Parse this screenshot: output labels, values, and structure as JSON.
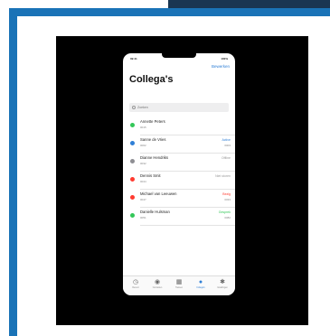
{
  "phone": {
    "status_time": "09:41",
    "status_right": "100%",
    "edit_label": "Bewerken",
    "title": "Collega's",
    "search_placeholder": "Zoeken"
  },
  "contacts": [
    {
      "name": "Annette Peters",
      "ext": "0015",
      "status": "",
      "ext2": "",
      "dot_color": "#34c759",
      "status_color": "#888888"
    },
    {
      "name": "Sanne de Vries",
      "ext": "0002",
      "status": "Active",
      "ext2": "0003",
      "dot_color": "#2f7fd6",
      "status_color": "#2f7fd6"
    },
    {
      "name": "Dianne Hendriks",
      "ext": "0032",
      "status": "Offline",
      "ext2": "",
      "dot_color": "#8e8e93",
      "status_color": "#999999"
    },
    {
      "name": "Dennis Smit",
      "ext": "0044",
      "status": "Niet storen",
      "ext2": "",
      "dot_color": "#ff3b30",
      "status_color": "#999999"
    },
    {
      "name": "Michael van Leeuwen",
      "ext": "0047",
      "status": "Bezig",
      "ext2": "0033",
      "dot_color": "#ff3b30",
      "status_color": "#ff3b30"
    },
    {
      "name": "Danielle Hulsman",
      "ext": "0051",
      "status": "Gesprek",
      "ext2": "0082",
      "dot_color": "#34c759",
      "status_color": "#34c759"
    }
  ],
  "tabs": [
    {
      "icon": "clock-icon",
      "glyph": "◷",
      "label": "Recent",
      "active": false
    },
    {
      "icon": "person-icon",
      "glyph": "◉",
      "label": "Contacten",
      "active": false
    },
    {
      "icon": "keypad-icon",
      "glyph": "▦",
      "label": "Toetsen",
      "active": false
    },
    {
      "icon": "people-icon",
      "glyph": "●",
      "label": "Collega's",
      "active": true
    },
    {
      "icon": "gear-icon",
      "glyph": "✱",
      "label": "Instellingen",
      "active": false
    }
  ],
  "colors": {
    "frame_blue": "#1a73b7",
    "frame_dark": "#1a3652",
    "accent": "#2f7fd6"
  }
}
